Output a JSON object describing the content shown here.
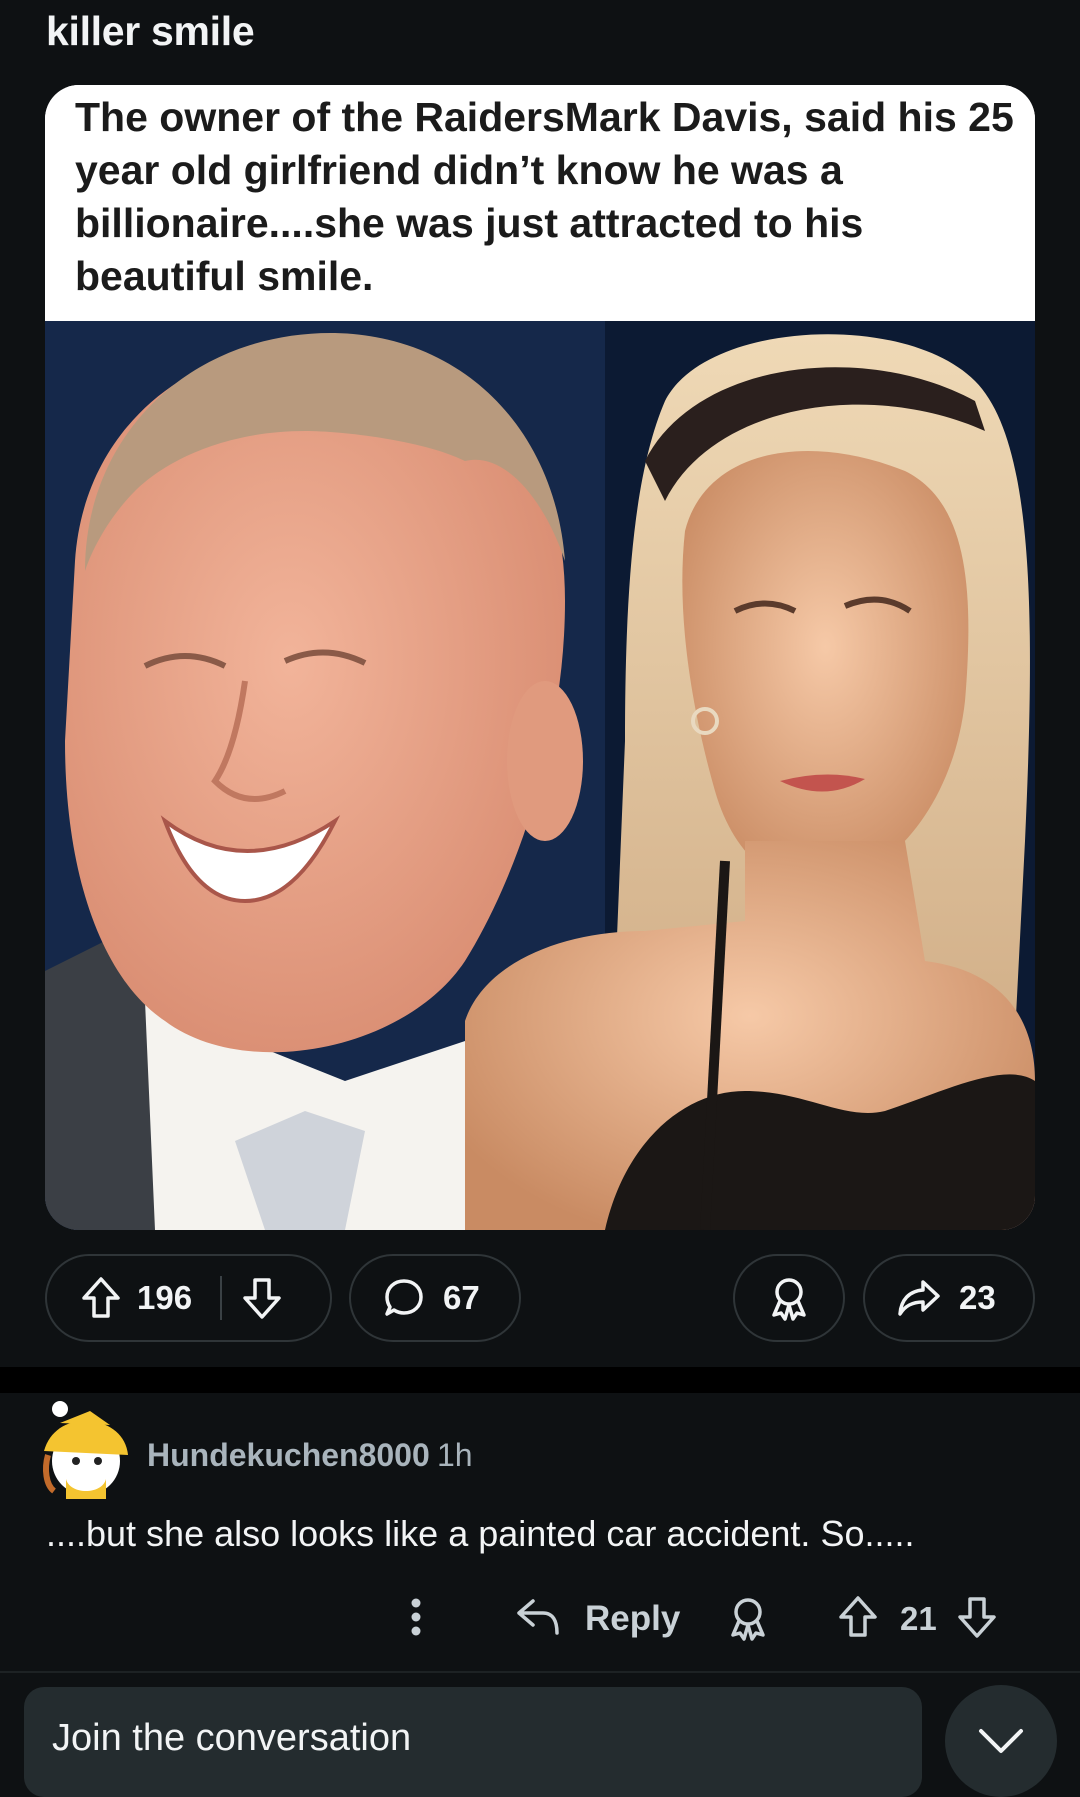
{
  "post": {
    "title": "killer smile",
    "caption": "The owner of the RaidersMark Davis, said his 25 year old girlfriend didn’t know he was a billionaire....she was just attracted to his beautiful smile.",
    "image_alt": "Photo of a smiling older man and a young blonde woman",
    "upvotes": "196",
    "comments": "67",
    "shares": "23"
  },
  "comment": {
    "username": "Hundekuchen8000",
    "time": "1h",
    "body": "....but she also looks like a painted car accident. So.....",
    "reply_label": "Reply",
    "votes": "21"
  },
  "composer": {
    "placeholder": "Join the conversation"
  },
  "icons": {
    "upvote": "arrow-up-icon",
    "downvote": "arrow-down-icon",
    "comment": "speech-bubble-icon",
    "award": "award-icon",
    "share": "share-arrow-icon",
    "more": "more-vertical-icon",
    "reply": "reply-arrow-icon",
    "collapse": "chevron-down-icon"
  },
  "colors": {
    "background": "#0e1113",
    "text": "#f2f4f5",
    "muted": "#a9b4bc",
    "pill_border": "#2f3538",
    "input_bg": "#242c2f"
  }
}
